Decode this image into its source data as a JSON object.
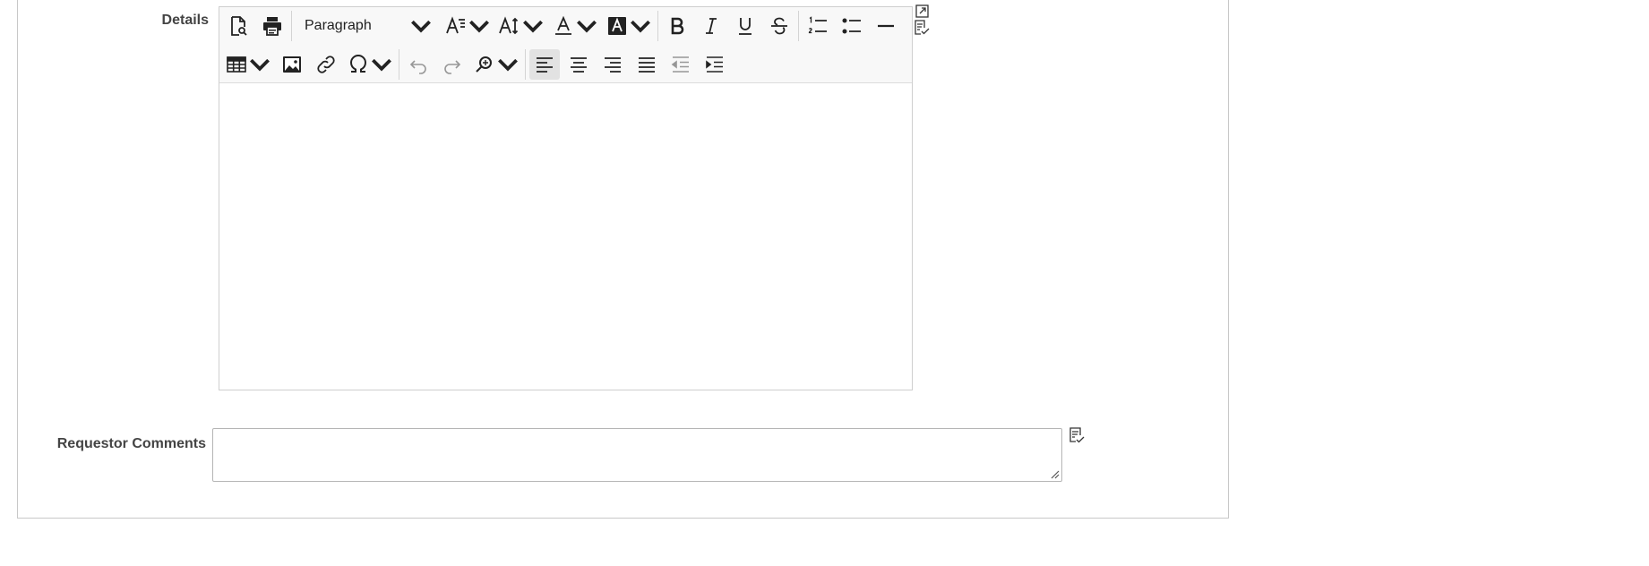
{
  "form": {
    "details_label": "Details",
    "requestor_comments_label": "Requestor Comments",
    "requestor_comments_value": ""
  },
  "editor": {
    "block_format": "Paragraph",
    "content": "",
    "toolbar_row1": [
      "preview-icon",
      "print-icon",
      "block-format-select",
      "font-family-icon",
      "font-size-icon",
      "text-color-icon",
      "background-color-icon",
      "bold-icon",
      "italic-icon",
      "underline-icon",
      "strikethrough-icon",
      "numbered-list-icon",
      "bullet-list-icon",
      "horizontal-line-icon"
    ],
    "toolbar_row2": [
      "table-icon",
      "image-icon",
      "link-icon",
      "special-character-icon",
      "undo-icon",
      "redo-icon",
      "find-replace-icon",
      "align-left-icon",
      "align-center-icon",
      "align-right-icon",
      "justify-icon",
      "outdent-icon",
      "indent-icon"
    ],
    "side_icons": [
      "expand-icon",
      "spellcheck-icon"
    ]
  },
  "colors": {
    "border": "#cfcfcf",
    "toolbar_bg": "#f8f8f8",
    "label": "#444444",
    "icon": "#222222"
  }
}
